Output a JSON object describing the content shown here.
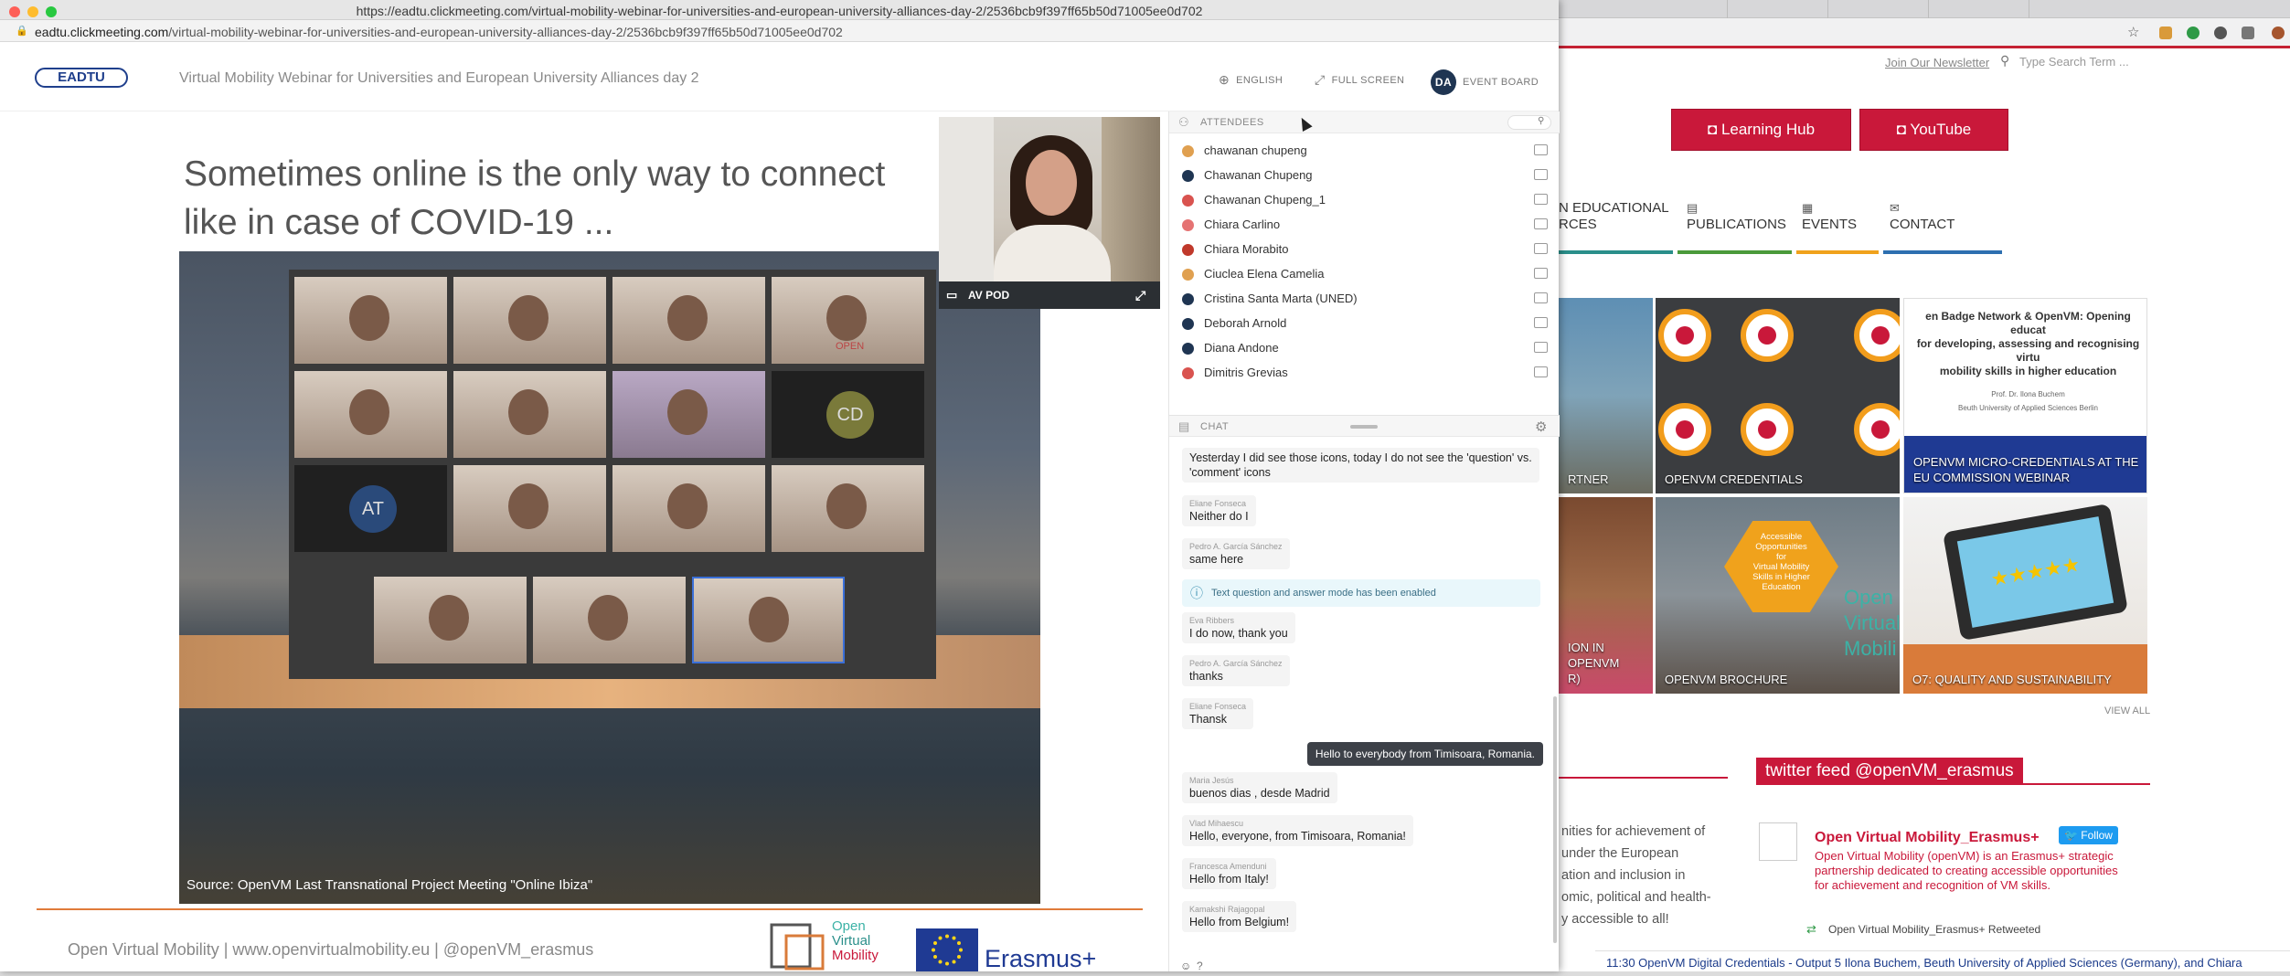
{
  "window": {
    "title": "https://eadtu.clickmeeting.com/virtual-mobility-webinar-for-universities-and-european-university-alliances-day-2/2536bcb9f397ff65b50d71005ee0d702",
    "address_host": "eadtu.clickmeeting.com",
    "address_path": "/virtual-mobility-webinar-for-universities-and-european-university-alliances-day-2/2536bcb9f397ff65b50d71005ee0d702"
  },
  "header": {
    "logo": "EADTU",
    "title": "Virtual Mobility Webinar for Universities and European University Alliances day 2",
    "language_label": "ENGLISH",
    "fullscreen_label": "FULL SCREEN",
    "event_board_label": "EVENT BOARD",
    "avatar_initials": "DA"
  },
  "slide": {
    "heading_line1": "Sometimes online is the only way to connect",
    "heading_line2": "like in case of COVID-19 ...",
    "source": "Source: OpenVM Last Transnational Project Meeting \"Online Ibiza\"",
    "footer": "Open Virtual Mobility | www.openvirtualmobility.eu | @openVM_erasmus",
    "logo_text1": "Open",
    "logo_text2": "Virtual",
    "logo_text3": "Mobility",
    "erasmus": "Erasmus+",
    "tile_initials_1": "CD",
    "tile_initials_2": "AT",
    "tile_sign": "OPEN"
  },
  "avpod": {
    "label": "AV POD"
  },
  "attendees": {
    "title": "ATTENDEES",
    "items": [
      {
        "name": "chawanan chupeng",
        "color": "#e0a050"
      },
      {
        "name": "Chawanan Chupeng",
        "color": "#1f3552"
      },
      {
        "name": "Chawanan Chupeng_1",
        "color": "#d9534f"
      },
      {
        "name": "Chiara Carlino",
        "color": "#e57373"
      },
      {
        "name": "Chiara Morabito",
        "color": "#c0392b"
      },
      {
        "name": "Ciuclea Elena Camelia",
        "color": "#e0a050"
      },
      {
        "name": "Cristina Santa Marta (UNED)",
        "color": "#1f3552"
      },
      {
        "name": "Deborah Arnold",
        "color": "#1f3552"
      },
      {
        "name": "Diana Andone",
        "color": "#1f3552"
      },
      {
        "name": "Dimitris Grevias",
        "color": "#d9534f"
      }
    ]
  },
  "chat": {
    "title": "CHAT",
    "messages": [
      {
        "who": "",
        "text1": "Yesterday I did see those icons, today I do not see the 'question' vs.",
        "text2": "'comment' icons"
      },
      {
        "who": "Eliane Fonseca",
        "text1": "Neither do I"
      },
      {
        "who": "Pedro A. García Sánchez",
        "text1": "same here"
      },
      {
        "who": "Eva Ribbers",
        "text1": "I do now, thank you"
      },
      {
        "who": "Pedro A. García Sánchez",
        "text1": "thanks"
      },
      {
        "who": "Eliane Fonseca",
        "text1": "Thansk"
      },
      {
        "who": "Maria Jesús",
        "text1": "buenos dias , desde Madrid"
      },
      {
        "who": "Vlad Mihaescu",
        "text1": "Hello, everyone, from Timisoara, Romania!"
      },
      {
        "who": "Francesca Amenduni",
        "text1": "Hello from Italy!"
      },
      {
        "who": "Kamakshi Rajagopal",
        "text1": "Hello from Belgium!"
      }
    ],
    "system_message": "Text question and answer mode has been enabled",
    "own_message": "Hello to everybody from Timisoara, Romania."
  },
  "background_site": {
    "newsletter": "Join Our Newsletter",
    "search_placeholder": "Type Search Term ...",
    "learning_hub": "◘ Learning Hub",
    "youtube": "◘ YouTube",
    "nav_educational_1": "N EDUCATIONAL",
    "nav_educational_2": "RCES",
    "nav_publications": "PUBLICATIONS",
    "nav_events": "EVENTS",
    "nav_contact": "CONTACT",
    "tile_partner": "RTNER",
    "tile_credentials": "OPENVM CREDENTIALS",
    "tile_micro": "OPENVM MICRO-CREDENTIALS AT THE EU COMMISSION WEBINAR",
    "tile_micro_img_1": "en Badge Network & OpenVM: Opening educat",
    "tile_micro_img_2": "for developing, assessing and recognising virtu",
    "tile_micro_img_3": "mobility skills in higher education",
    "tile_micro_img_4": "Prof. Dr. Ilona Buchem",
    "tile_micro_img_5": "Beuth University of Applied Sciences Berlin",
    "tile_openvm_in_1": "ION IN OPENVM",
    "tile_openvm_in_2": "R)",
    "tile_brochure": "OPENVM BROCHURE",
    "tile_brochure_img_1": "Accessible",
    "tile_brochure_img_2": "Opportunities",
    "tile_brochure_img_3": "for",
    "tile_brochure_img_4": "Virtual Mobility",
    "tile_brochure_img_5": "Skills in Higher",
    "tile_brochure_img_6": "Education",
    "tile_brochure_big": "Open Virtual Mobili",
    "tile_quality": "O7: QUALITY AND SUSTAINABILITY",
    "view_all": "VIEW ALL",
    "left_text_1": "nities for achievement of",
    "left_text_2": "under the European",
    "left_text_3": "ation and inclusion in",
    "left_text_4": "omic, political and health-",
    "left_text_5": "y accessible to all!",
    "twitter_head": "twitter feed @openVM_erasmus",
    "tw_account": "Open Virtual Mobility_Erasmus+",
    "tw_follow": "Follow",
    "tw_body_1": "Open Virtual Mobility (openVM) is an Erasmus+ strategic",
    "tw_body_2": "partnership dedicated to creating accessible opportunities",
    "tw_body_3": "for achievement and recognition of VM skills.",
    "tw_retweet": "Open Virtual Mobility_Erasmus+ Retweeted",
    "bottom_text": "11:30 OpenVM Digital Credentials - Output 5 Ilona Buchem, Beuth University of Applied Sciences (Germany), and Chiara"
  }
}
